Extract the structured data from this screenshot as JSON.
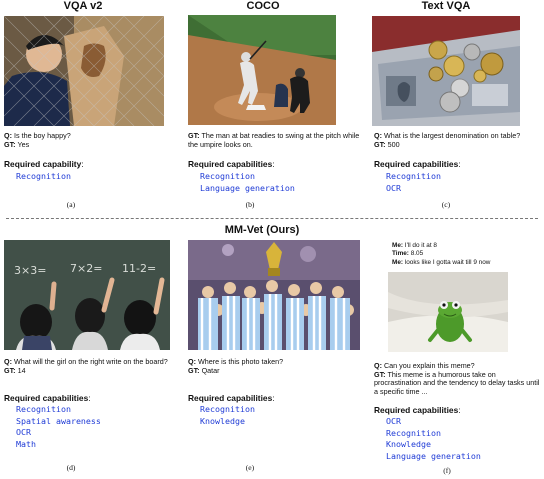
{
  "panels": [
    {
      "id": "a",
      "title": "VQA v2",
      "q_label": "Q:",
      "question": "Is the boy happy?",
      "gt_label": "GT:",
      "answer": "Yes",
      "cap_heading": "Required capability",
      "cap_colon": ":",
      "capabilities": [
        "Recognition"
      ],
      "sub_label": "(a)"
    },
    {
      "id": "b",
      "title": "COCO",
      "gt_label": "GT:",
      "answer": "The man at bat readies to swing at the pitch while the umpire looks on.",
      "cap_heading": "Required capabilities",
      "cap_colon": ":",
      "capabilities": [
        "Recognition",
        "Language generation"
      ],
      "sub_label": "(b)"
    },
    {
      "id": "c",
      "title": "Text VQA",
      "q_label": "Q:",
      "question": "What is the largest denomination on table?",
      "gt_label": "GT:",
      "answer": "500",
      "cap_heading": "Required capabilities",
      "cap_colon": ":",
      "capabilities": [
        "Recognition",
        "OCR"
      ],
      "sub_label": "(c)"
    },
    {
      "id": "d",
      "q_label": "Q:",
      "question": "What will the girl on the right write on the board?",
      "gt_label": "GT:",
      "answer": "14",
      "cap_heading": "Required capabilities",
      "cap_colon": ":",
      "capabilities": [
        "Recognition",
        "Spatial awareness",
        "OCR",
        "Math"
      ],
      "board_text": [
        "3×3=",
        "7×2=",
        "11-2="
      ],
      "sub_label": "(d)"
    },
    {
      "id": "e",
      "q_label": "Q:",
      "question": "Where is this photo taken?",
      "gt_label": "GT:",
      "answer": "Qatar",
      "cap_heading": "Required capabilities",
      "cap_colon": ":",
      "capabilities": [
        "Recognition",
        "Knowledge"
      ],
      "sub_label": "(e)"
    },
    {
      "id": "f",
      "meme_lines": [
        {
          "speaker": "Me:",
          "text": "I'll do it at 8"
        },
        {
          "speaker": "Time:",
          "text": "8.05"
        },
        {
          "speaker": "Me:",
          "text": "looks like I gotta wait till 9 now"
        }
      ],
      "q_label": "Q:",
      "question": "Can you explain this meme?",
      "gt_label": "GT:",
      "answer": "This meme is a humorous take on procrastination and the tendency to delay tasks until a specific time ...",
      "cap_heading": "Required capabilities",
      "cap_colon": ":",
      "capabilities": [
        "OCR",
        "Recognition",
        "Knowledge",
        "Language generation"
      ],
      "sub_label": "(f)"
    }
  ],
  "center_title": "MM-Vet (Ours)",
  "colors": {
    "capability_text": "#1f3bd6",
    "divider": "#777777"
  }
}
